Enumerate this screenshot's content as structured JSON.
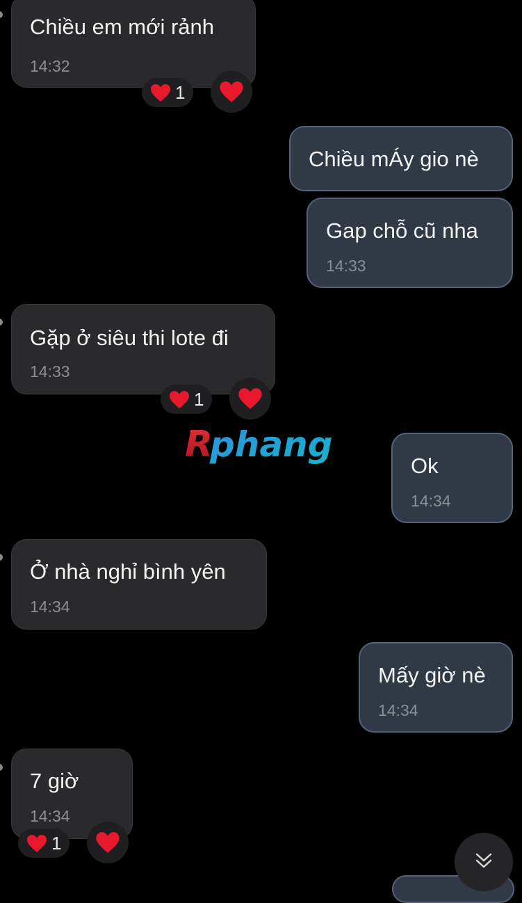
{
  "conversation": {
    "messages": [
      {
        "direction": "incoming",
        "text": "Chiều em mới rảnh",
        "time": "14:32",
        "reaction": {
          "emoji": "heart",
          "count": "1"
        }
      },
      {
        "direction": "outgoing",
        "text": "Chiều mÁy gio nè",
        "time": ""
      },
      {
        "direction": "outgoing",
        "text": "Gap chỗ cũ nha",
        "time": "14:33"
      },
      {
        "direction": "incoming",
        "text": "Gặp ở siêu thi lote đi",
        "time": "14:33",
        "reaction": {
          "emoji": "heart",
          "count": "1"
        }
      },
      {
        "direction": "outgoing",
        "text": "Ok",
        "time": "14:34"
      },
      {
        "direction": "incoming",
        "text": "Ở nhà nghỉ bình yên",
        "time": "14:34"
      },
      {
        "direction": "outgoing",
        "text": "Mấy giờ nè",
        "time": "14:34"
      },
      {
        "direction": "incoming",
        "text": "7 giờ",
        "time": "14:34",
        "reaction": {
          "emoji": "heart",
          "count": "1"
        }
      }
    ]
  },
  "watermark": {
    "text": "Rphang"
  },
  "scroll_button": {
    "icon": "double-chevron-down-icon"
  },
  "colors": {
    "background": "#000000",
    "incoming_bubble": "#2a2a2c",
    "outgoing_bubble": "#313846",
    "outgoing_border": "#56627a",
    "time_text": "#8d8e92",
    "heart": "#e8192c"
  }
}
